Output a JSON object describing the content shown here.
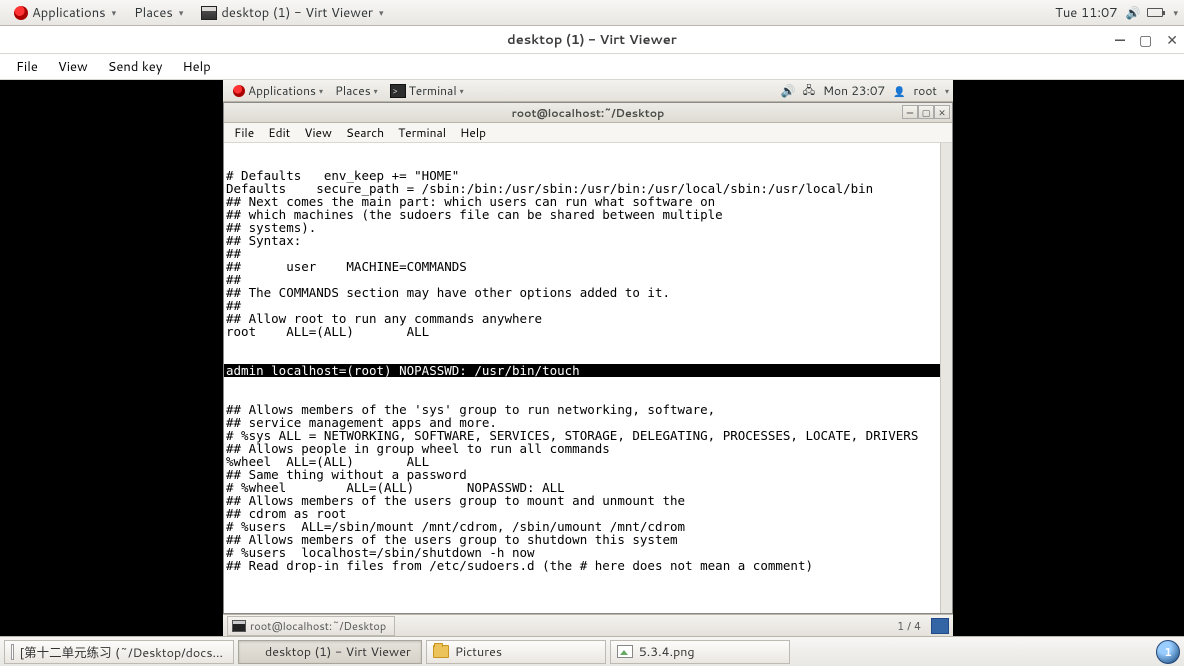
{
  "host_panel": {
    "applications": "Applications",
    "places": "Places",
    "active_window": "desktop (1) - Virt Viewer",
    "clock": "Tue 11:07"
  },
  "viewer": {
    "title": "desktop (1) - Virt Viewer",
    "menu": {
      "file": "File",
      "view": "View",
      "sendkey": "Send key",
      "help": "Help"
    }
  },
  "guest_panel": {
    "applications": "Applications",
    "places": "Places",
    "active": "Terminal",
    "clock": "Mon 23:07",
    "user": "root"
  },
  "terminal": {
    "title": "root@localhost:~/Desktop",
    "menu": {
      "file": "File",
      "edit": "Edit",
      "view": "View",
      "search": "Search",
      "terminal": "Terminal",
      "help": "Help"
    },
    "lines_pre": [
      "# Defaults   env_keep += \"HOME\"",
      "",
      "Defaults    secure_path = /sbin:/bin:/usr/sbin:/usr/bin:/usr/local/sbin:/usr/local/bin",
      "",
      "## Next comes the main part: which users can run what software on",
      "## which machines (the sudoers file can be shared between multiple",
      "## systems).",
      "## Syntax:",
      "##",
      "##      user    MACHINE=COMMANDS",
      "##",
      "## The COMMANDS section may have other options added to it.",
      "##",
      "## Allow root to run any commands anywhere",
      "root    ALL=(ALL)       ALL"
    ],
    "highlight": "admin localhost=(root) NOPASSWD: /usr/bin/touch",
    "lines_post": [
      "## Allows members of the 'sys' group to run networking, software,",
      "## service management apps and more.",
      "# %sys ALL = NETWORKING, SOFTWARE, SERVICES, STORAGE, DELEGATING, PROCESSES, LOCATE, DRIVERS",
      "",
      "## Allows people in group wheel to run all commands",
      "%wheel  ALL=(ALL)       ALL",
      "",
      "## Same thing without a password",
      "# %wheel        ALL=(ALL)       NOPASSWD: ALL",
      "",
      "## Allows members of the users group to mount and unmount the",
      "## cdrom as root",
      "# %users  ALL=/sbin/mount /mnt/cdrom, /sbin/umount /mnt/cdrom",
      "",
      "## Allows members of the users group to shutdown this system",
      "# %users  localhost=/sbin/shutdown -h now",
      "",
      "## Read drop-in files from /etc/sudoers.d (the # here does not mean a comment)"
    ]
  },
  "guest_footer": {
    "task": "root@localhost:~/Desktop",
    "workspace": "1 / 4"
  },
  "host_taskbar": {
    "task1": "[第十二单元练习 (~/Desktop/docs...",
    "task2": "desktop (1) - Virt Viewer",
    "task3": "Pictures",
    "task4": "5.3.4.png",
    "ws": "1"
  }
}
